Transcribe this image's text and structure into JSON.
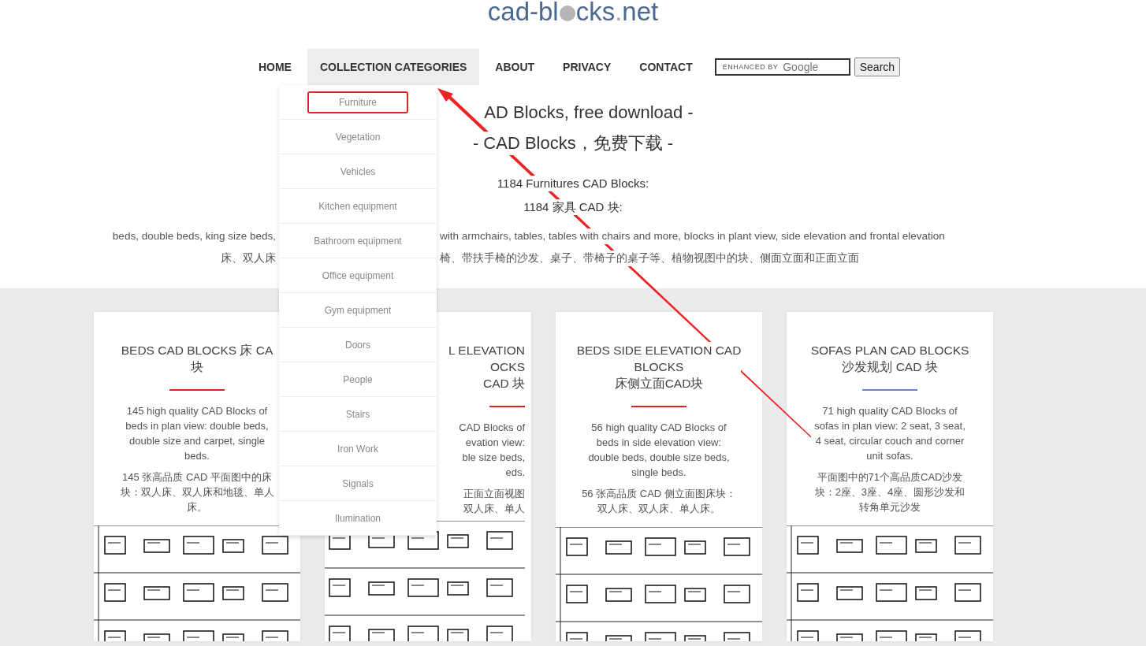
{
  "logo": {
    "part_1": "cad-bl",
    "part_2": "cks",
    "dot": ".",
    "part_3": "net"
  },
  "nav": {
    "items": [
      {
        "label": "HOME",
        "selected": false
      },
      {
        "label": "COLLECTION CATEGORIES",
        "selected": true
      },
      {
        "label": "ABOUT",
        "selected": false
      },
      {
        "label": "PRIVACY",
        "selected": false
      },
      {
        "label": "CONTACT",
        "selected": false
      }
    ],
    "search": {
      "placeholder_prefix": "ENHANCED BY",
      "placeholder_brand": "Google",
      "button": "Search"
    }
  },
  "categories_menu": {
    "items": [
      {
        "label": "Furniture",
        "highlighted": true
      },
      {
        "label": "Vegetation",
        "highlighted": false
      },
      {
        "label": "Vehicles",
        "highlighted": false
      },
      {
        "label": "Kitchen equipment",
        "highlighted": false
      },
      {
        "label": "Bathroom equipment",
        "highlighted": false
      },
      {
        "label": "Office equipment",
        "highlighted": false
      },
      {
        "label": "Gym equipment",
        "highlighted": false
      },
      {
        "label": "Doors",
        "highlighted": false
      },
      {
        "label": "People",
        "highlighted": false
      },
      {
        "label": "Stairs",
        "highlighted": false
      },
      {
        "label": "Iron Work",
        "highlighted": false
      },
      {
        "label": "Signals",
        "highlighted": false
      },
      {
        "label": "Ilumination",
        "highlighted": false
      }
    ]
  },
  "intro": {
    "heading_1": "AD Blocks, free download -",
    "heading_2": "- CAD Blocks，免费下载 -",
    "count_en": "1184 Furnitures CAD Blocks:",
    "count_zh": "1184 家具 CAD 块:",
    "description_en": {
      "left": "beds, double beds, king size beds,",
      "right": "with armchairs, tables, tables with chairs and more, blocks in plant view, side elevation and frontal elevation"
    },
    "description_zh": {
      "left": "床、双人床",
      "right": "椅、带扶手椅的沙发、桌子、带椅子的桌子等、植物视图中的块、侧面立面和正面立面"
    }
  },
  "cards": [
    {
      "kind": "full",
      "title_lines": [
        "BEDS CAD BLOCKS 床 CA",
        "块"
      ],
      "color": "#e02020",
      "description_en": "145 high quality CAD Blocks of beds in plan view: double beds, double size and carpet, single beds.",
      "description_zh": "145 张高品质 CAD 平面图中的床块：双人床、双人床和地毯、单人床。"
    },
    {
      "kind": "fragment",
      "title_lines": [
        "L ELEVATION",
        "OCKS",
        "CAD 块"
      ],
      "color": "#e02020",
      "description_en_lines": [
        "CAD Blocks of",
        "evation view:",
        "ble size beds,",
        "eds."
      ],
      "description_zh_lines": [
        "正面立面视图",
        "双人床、单人"
      ]
    },
    {
      "kind": "full",
      "title_lines": [
        "BEDS SIDE ELEVATION CAD",
        "BLOCKS",
        "床侧立面CAD块"
      ],
      "color": "#e02020",
      "description_en": "56 high quality CAD Blocks of beds in side elevation view: double beds, double size beds, single beds.",
      "description_zh": "56 张高品质 CAD 侧立面图床块：双人床、双人床、单人床。"
    },
    {
      "kind": "full",
      "title_lines": [
        "SOFAS PLAN CAD BLOCKS",
        "沙发规划 CAD 块"
      ],
      "color": "#6b7fe0",
      "description_en": "71 high quality CAD Blocks of sofas in plan view: 2 seat, 3 seat, 4 seat, circular couch and corner unit sofas.",
      "description_zh": "平面图中的71个高品质CAD沙发块：2座、3座、4座、圆形沙发和转角单元沙发"
    }
  ]
}
